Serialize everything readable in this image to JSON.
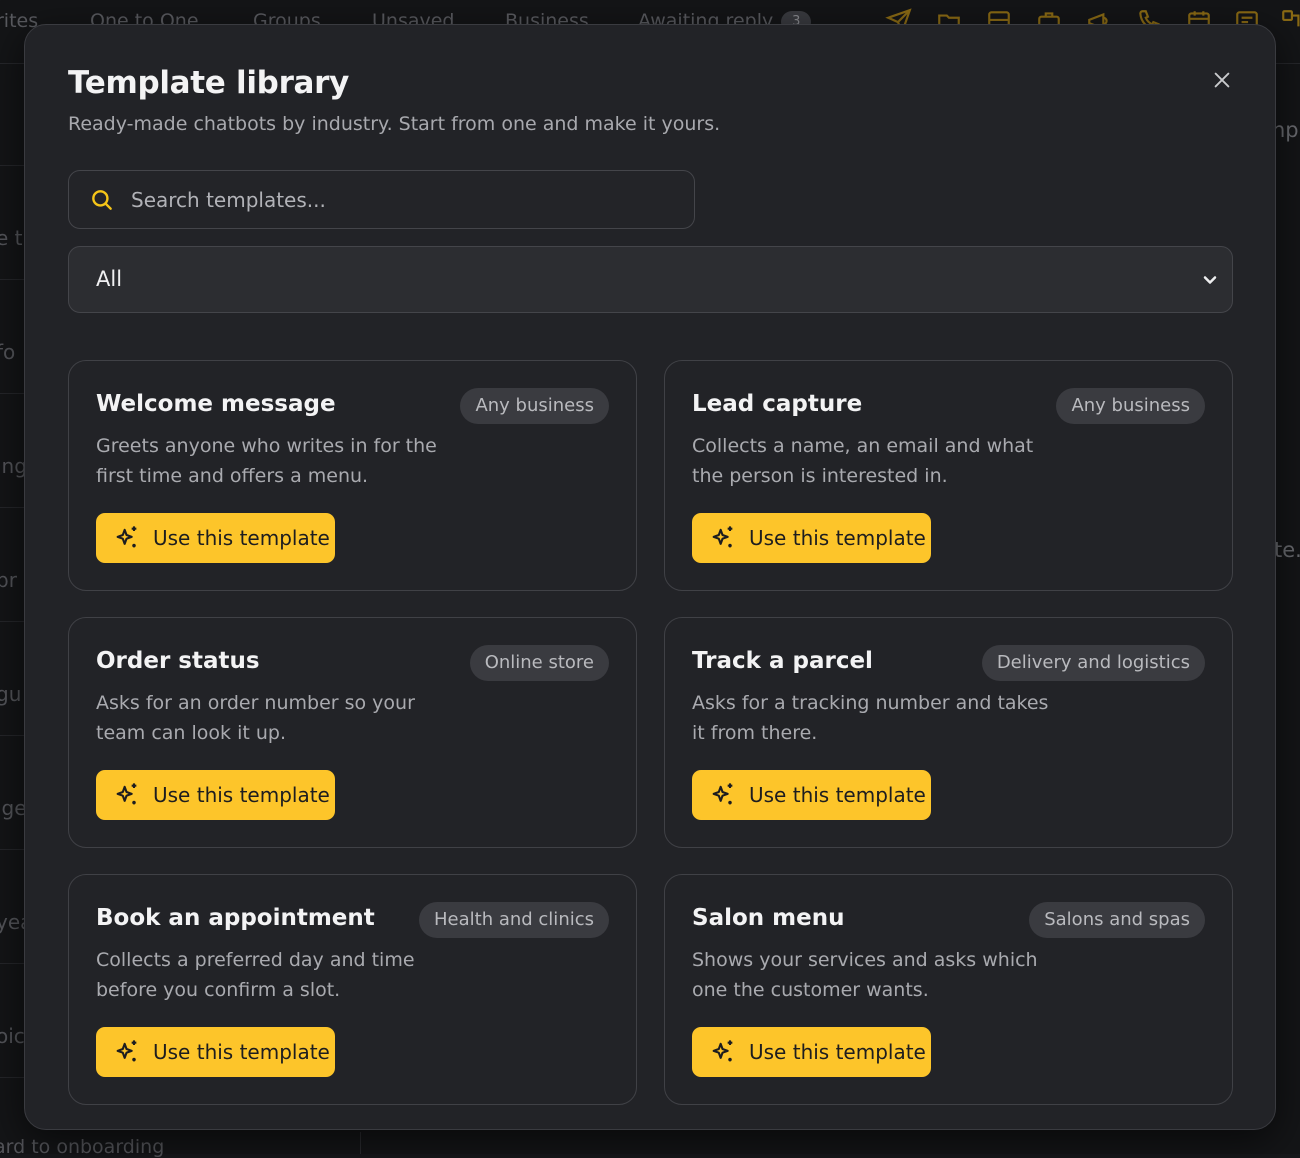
{
  "background": {
    "tabs": [
      {
        "label": "rites"
      },
      {
        "label": "One to One"
      },
      {
        "label": "Groups"
      },
      {
        "label": "Unsaved"
      },
      {
        "label": "Business"
      },
      {
        "label": "Awaiting reply",
        "badge": "3"
      }
    ],
    "left_fragments": [
      "e t",
      "fo",
      "ing",
      "pr",
      "gu",
      "lge",
      "yea",
      "oic"
    ],
    "right_fragments": [
      "npl",
      "te."
    ],
    "bottom_text": "ard to onboarding"
  },
  "modal": {
    "title": "Template library",
    "subtitle": "Ready-made chatbots by industry. Start from one and make it yours.",
    "search": {
      "placeholder": "Search templates...",
      "value": ""
    },
    "category": {
      "selected": "All"
    },
    "templates": [
      {
        "title": "Welcome message",
        "tag": "Any business",
        "description": "Greets anyone who writes in for the first time and offers a menu.",
        "button_label": "Use this template"
      },
      {
        "title": "Lead capture",
        "tag": "Any business",
        "description": "Collects a name, an email and what the person is interested in.",
        "button_label": "Use this template"
      },
      {
        "title": "Order status",
        "tag": "Online store",
        "description": "Asks for an order number so your team can look it up.",
        "button_label": "Use this template"
      },
      {
        "title": "Track a parcel",
        "tag": "Delivery and logistics",
        "description": "Asks for a tracking number and takes it from there.",
        "button_label": "Use this template"
      },
      {
        "title": "Book an appointment",
        "tag": "Health and clinics",
        "description": "Collects a preferred day and time before you confirm a slot.",
        "button_label": "Use this template"
      },
      {
        "title": "Salon menu",
        "tag": "Salons and spas",
        "description": "Shows your services and asks which one the customer wants.",
        "button_label": "Use this template"
      }
    ]
  },
  "colors": {
    "accent": "#fdc52a",
    "modal_bg": "#222327",
    "card_border": "#404146",
    "tag_bg": "#3a3b40"
  },
  "icons": {
    "close": "close-icon",
    "search": "search-icon",
    "chevron": "chevron-down-icon",
    "button": "sparkle-icon"
  }
}
